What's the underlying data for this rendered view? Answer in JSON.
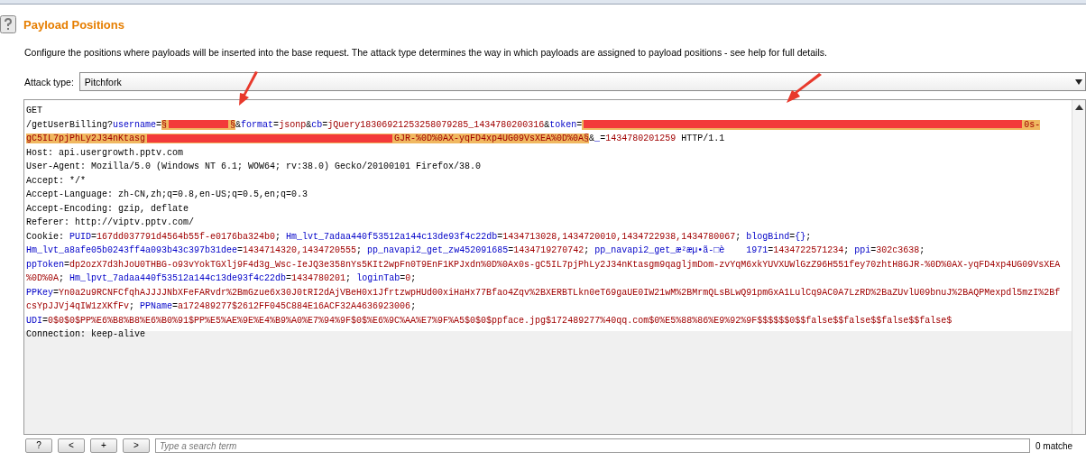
{
  "header": {
    "title": "Payload Positions",
    "description": "Configure the positions where payloads will be inserted into the base request. The attack type determines the way in which payloads are assigned to payload positions - see help for full details."
  },
  "attack_type": {
    "label": "Attack type:",
    "value": "Pitchfork"
  },
  "request": {
    "lines": [
      {
        "segments": [
          {
            "kind": "text",
            "text": "GET"
          }
        ]
      },
      {
        "segments": [
          {
            "kind": "text",
            "text": "/getUserBilling?"
          },
          {
            "kind": "key",
            "text": "username"
          },
          {
            "kind": "text",
            "text": "="
          },
          {
            "kind": "payload",
            "segments": [
              {
                "kind": "marker",
                "text": "§"
              },
              {
                "kind": "redacted"
              },
              {
                "kind": "marker",
                "text": "§"
              }
            ]
          },
          {
            "kind": "text",
            "text": "&"
          },
          {
            "kind": "key",
            "text": "format"
          },
          {
            "kind": "text",
            "text": "="
          },
          {
            "kind": "value",
            "text": "jsonp"
          },
          {
            "kind": "text",
            "text": "&"
          },
          {
            "kind": "key",
            "text": "cb"
          },
          {
            "kind": "text",
            "text": "="
          },
          {
            "kind": "value",
            "text": "jQuery18306921253258079285_1434780200316"
          },
          {
            "kind": "text",
            "text": "&"
          },
          {
            "kind": "key",
            "text": "token"
          },
          {
            "kind": "text",
            "text": "="
          },
          {
            "kind": "payload",
            "segments": [
              {
                "kind": "redacted"
              },
              {
                "kind": "value",
                "text": "0s-"
              }
            ]
          }
        ]
      },
      {
        "segments": [
          {
            "kind": "payload",
            "segments": [
              {
                "kind": "value",
                "text": "gC5IL7pjPhLy2J34nKtasg"
              },
              {
                "kind": "redacted"
              },
              {
                "kind": "value",
                "text": "GJR-%0D%0AX-yqFD4xp4UG09VsXEA%0D%0A"
              },
              {
                "kind": "marker",
                "text": "§"
              }
            ]
          },
          {
            "kind": "text",
            "text": "&"
          },
          {
            "kind": "key",
            "text": "_"
          },
          {
            "kind": "text",
            "text": "="
          },
          {
            "kind": "value",
            "text": "1434780201259"
          },
          {
            "kind": "text",
            "text": " HTTP/1.1"
          }
        ]
      },
      {
        "segments": [
          {
            "kind": "text",
            "text": "Host: api.usergrowth.pptv.com"
          }
        ]
      },
      {
        "segments": [
          {
            "kind": "text",
            "text": "User-Agent: Mozilla/5.0 (Windows NT 6.1; WOW64; rv:38.0) Gecko/20100101 Firefox/38.0"
          }
        ]
      },
      {
        "segments": [
          {
            "kind": "text",
            "text": "Accept: */*"
          }
        ]
      },
      {
        "segments": [
          {
            "kind": "text",
            "text": "Accept-Language: zh-CN,zh;q=0.8,en-US;q=0.5,en;q=0.3"
          }
        ]
      },
      {
        "segments": [
          {
            "kind": "text",
            "text": "Accept-Encoding: gzip, deflate"
          }
        ]
      },
      {
        "segments": [
          {
            "kind": "text",
            "text": "Referer: http://viptv.pptv.com/"
          }
        ]
      },
      {
        "segments": [
          {
            "kind": "text",
            "text": "Cookie: "
          },
          {
            "kind": "key",
            "text": "PUID"
          },
          {
            "kind": "text",
            "text": "="
          },
          {
            "kind": "value",
            "text": "167dd037791d4564b55f-e0176ba324b0"
          },
          {
            "kind": "text",
            "text": "; "
          },
          {
            "kind": "key",
            "text": "Hm_lvt_7adaa440f53512a144c13de93f4c22db"
          },
          {
            "kind": "text",
            "text": "="
          },
          {
            "kind": "value",
            "text": "1434713028,1434720010,1434722938,1434780067"
          },
          {
            "kind": "text",
            "text": "; "
          },
          {
            "kind": "key",
            "text": "blogBind"
          },
          {
            "kind": "text",
            "text": "="
          },
          {
            "kind": "key",
            "text": "{}"
          },
          {
            "kind": "text",
            "text": ";"
          }
        ]
      },
      {
        "segments": [
          {
            "kind": "key",
            "text": "Hm_lvt_a8afe05b0243ff4a093b43c397b31dee"
          },
          {
            "kind": "text",
            "text": "="
          },
          {
            "kind": "value",
            "text": "1434714320,1434720555"
          },
          {
            "kind": "text",
            "text": "; "
          },
          {
            "kind": "key",
            "text": "pp_navapi2_get_zw452091685"
          },
          {
            "kind": "text",
            "text": "="
          },
          {
            "kind": "value",
            "text": "1434719270742"
          },
          {
            "kind": "text",
            "text": "; "
          },
          {
            "kind": "key",
            "text": "pp_navapi2_get_æ²æµ•ã-□è    1971"
          },
          {
            "kind": "text",
            "text": "="
          },
          {
            "kind": "value",
            "text": "1434722571234"
          },
          {
            "kind": "text",
            "text": "; "
          },
          {
            "kind": "key",
            "text": "ppi"
          },
          {
            "kind": "text",
            "text": "="
          },
          {
            "kind": "value",
            "text": "302c3638"
          },
          {
            "kind": "text",
            "text": ";"
          }
        ]
      },
      {
        "segments": [
          {
            "kind": "key",
            "text": "ppToken"
          },
          {
            "kind": "text",
            "text": "="
          },
          {
            "kind": "value",
            "text": "dp2ozX7d3hJoU0THBG-o93vYokTGXlj9F4d3g_Wsc-IeJQ3e358nYs5KIt2wpFn0T9EnF1KPJxdn%0D%0Ax0s-gC5IL7pjPhLy2J34nKtasgm9qagljmDom-zvYqM6xkYUVXUWlGzZ96H551fey70zhtH8GJR-%0D%0AX-yqFD4xp4UG09VsXEA"
          }
        ]
      },
      {
        "segments": [
          {
            "kind": "value",
            "text": "%0D%0A"
          },
          {
            "kind": "text",
            "text": "; "
          },
          {
            "kind": "key",
            "text": "Hm_lpvt_7adaa440f53512a144c13de93f4c22db"
          },
          {
            "kind": "text",
            "text": "="
          },
          {
            "kind": "value",
            "text": "1434780201"
          },
          {
            "kind": "text",
            "text": "; "
          },
          {
            "kind": "key",
            "text": "loginTab"
          },
          {
            "kind": "text",
            "text": "="
          },
          {
            "kind": "value",
            "text": "0"
          },
          {
            "kind": "text",
            "text": ";"
          }
        ]
      },
      {
        "segments": [
          {
            "kind": "key",
            "text": "PPKey"
          },
          {
            "kind": "text",
            "text": "="
          },
          {
            "kind": "value",
            "text": "Yn0a2u9RCNFCfqhAJJJJNbXFeFARvdr%2BmGzue6x30J0tRI2dAjVBeH0x1JfrtzwpHUd00xiHaHx77Bfao4Zqv%2BXERBTLkn0eT69gaUE0IW21wM%2BMrmQLsBLwQ91pmGxA1LulCq9AC0A7LzRD%2BaZUvlU09bnuJ%2BAQPMexpdl5mzI%2Bf"
          }
        ]
      },
      {
        "segments": [
          {
            "kind": "value",
            "text": "csYpJJVj4qIW1zXKfFv"
          },
          {
            "kind": "text",
            "text": "; "
          },
          {
            "kind": "key",
            "text": "PPName"
          },
          {
            "kind": "text",
            "text": "="
          },
          {
            "kind": "value",
            "text": "a172489277$2612FF045C884E16ACF32A4636923006"
          },
          {
            "kind": "text",
            "text": ";"
          }
        ]
      },
      {
        "segments": [
          {
            "kind": "key",
            "text": "UDI"
          },
          {
            "kind": "text",
            "text": "="
          },
          {
            "kind": "value",
            "text": "0$0$0$PP%E6%B8%B8%E6%B0%91$PP%E5%AE%9E%E4%B9%A0%E7%94%9F$0$%E6%9C%AA%E7%9F%A5$0$0$ppface.jpg$172489277%40qq.com$0%E5%88%86%E9%92%9F$$$$$$0$$false$$false$$false$$false$"
          }
        ]
      },
      {
        "segments": [
          {
            "kind": "text",
            "text": "Connection: keep-alive"
          }
        ]
      }
    ]
  },
  "search_bar": {
    "buttons": [
      "?",
      "<",
      "+",
      ">"
    ],
    "placeholder": "Type a search term",
    "matches": "0 matche"
  }
}
